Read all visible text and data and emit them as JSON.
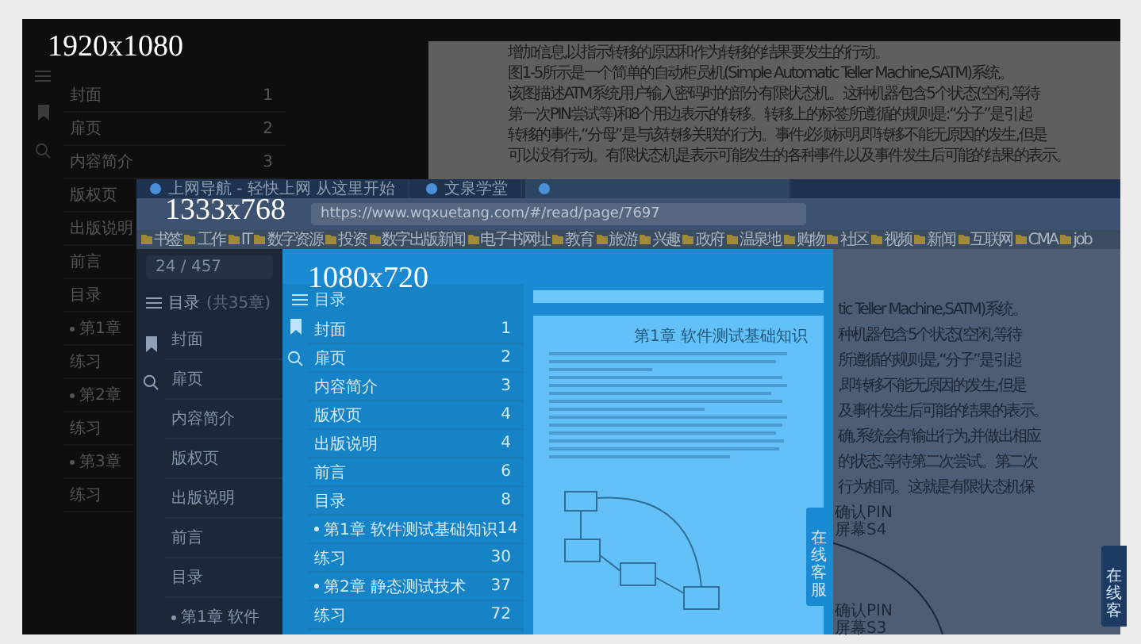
{
  "large_screen": {
    "label": "1920x1080",
    "toc": [
      {
        "title": "封面",
        "page": "1"
      },
      {
        "title": "扉页",
        "page": "2"
      },
      {
        "title": "内容简介",
        "page": "3"
      },
      {
        "title": "版权页"
      },
      {
        "title": "出版说明"
      },
      {
        "title": "前言"
      },
      {
        "title": "目录"
      },
      {
        "title": "第1章",
        "kind": "chapter"
      },
      {
        "title": "练习"
      },
      {
        "title": "第2章",
        "kind": "chapter"
      },
      {
        "title": "练习"
      },
      {
        "title": "第3章",
        "kind": "chapter"
      },
      {
        "title": "练习"
      }
    ],
    "text_lines": [
      "增加信息,以指示转移的原因和作为转移的结果要发生的行动。",
      "图1-5所示是一个简单的自动柜员机(Simple Automatic Teller Machine,SATM)系统。",
      "该图描述ATM系统用户输入密码时的部分有限状态机。这种机器包含5个状态(空闲,等待",
      "第一次PIN尝试等)和8个用边表示的转移。转移上的标签所遵循的规则是:“分子”是引起",
      "转移的事件,“分母”是与该转移关联的行为。事件必须标明,即转移不能无原因的发生,但是",
      "可以没有行动。有限状态机是表示可能发生的各种事件,以及事件发生后可能的结果的表示。"
    ]
  },
  "medium_screen": {
    "label": "1333x768",
    "tabs": [
      {
        "title": "上网导航 - 轻快上网 从这里开始",
        "selected": false
      },
      {
        "title": "文泉学堂",
        "selected": false
      },
      {
        "selected": true
      }
    ],
    "url": "https://www.wqxuetang.com/#/read/page/7697",
    "bookmarks": [
      "书签",
      "工作",
      "IT",
      "数字资源",
      "投资",
      "数字出版新闻",
      "电子书网址",
      "教育",
      "旅游",
      "兴趣",
      "政府",
      "温泉地",
      "购物",
      "社区",
      "视频",
      "新闻",
      "互联网",
      "CMA",
      "job"
    ],
    "page_counter": "24 / 457",
    "toc_header": "目录",
    "toc_count": "(共35章)",
    "toc": [
      {
        "title": "封面"
      },
      {
        "title": "扉页"
      },
      {
        "title": "内容简介"
      },
      {
        "title": "版权页"
      },
      {
        "title": "出版说明"
      },
      {
        "title": "前言"
      },
      {
        "title": "目录"
      },
      {
        "title": "第1章 软件",
        "kind": "chapter"
      }
    ],
    "text_lines": [
      "tic Teller Machine,SATM)系统。",
      "种机器包含5个状态(空闲,等待",
      "所遵循的规则是,“分子”是引起",
      ",即转移不能无原因的发生,但是",
      "及事件发生后可能的结果的表示。",
      "确,系统会有输出行为,并做出相应",
      "的状态,等待第二次尝试。第二次",
      "行为相同。这就是有限状态机保"
    ],
    "figure_labels": [
      "确认PIN",
      "屏幕S4",
      "确认PIN",
      "屏幕S3"
    ],
    "service_tab": "在线客"
  },
  "small_screen": {
    "label": "1080x720",
    "toc_header": "目录",
    "toc": [
      {
        "title": "封面",
        "page": "1"
      },
      {
        "title": "扉页",
        "page": "2"
      },
      {
        "title": "内容简介",
        "page": "3"
      },
      {
        "title": "版权页",
        "page": "4"
      },
      {
        "title": "出版说明",
        "page": "4"
      },
      {
        "title": "前言",
        "page": "6"
      },
      {
        "title": "目录",
        "page": "8"
      },
      {
        "title": "第1章 软件测试基础知识",
        "page": "14",
        "kind": "chapter"
      },
      {
        "title": "练习",
        "page": "30"
      },
      {
        "title": "第2章 静态测试技术",
        "page": "37",
        "kind": "chapter"
      },
      {
        "title": "练习",
        "page": "72"
      }
    ],
    "chapter_header": "第1章 软件测试基础知识",
    "service_tab": "在线客服"
  }
}
